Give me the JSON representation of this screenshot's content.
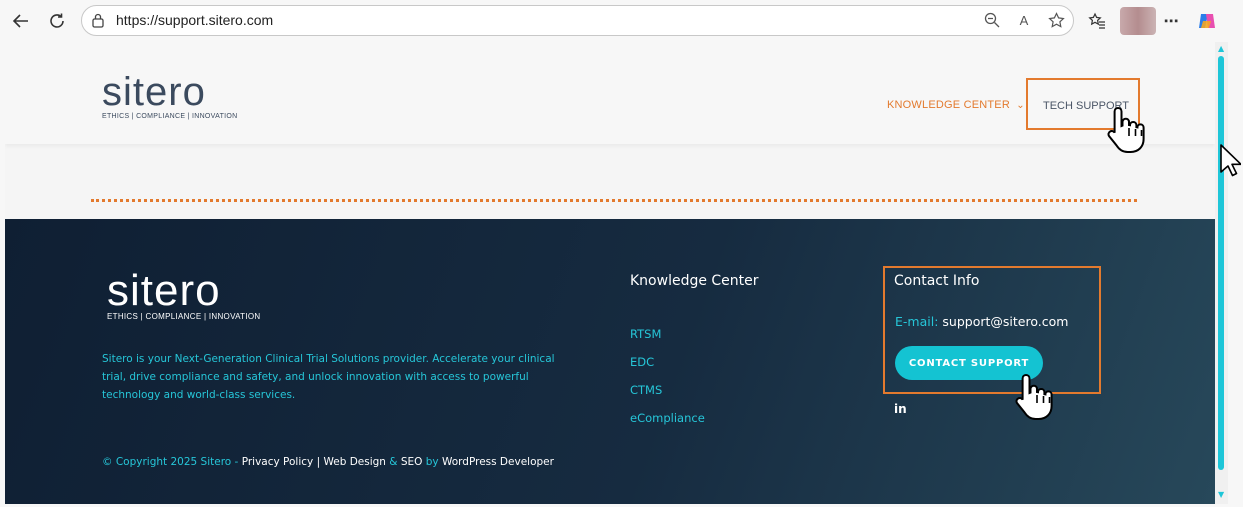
{
  "browser": {
    "url": "https://support.sitero.com"
  },
  "header": {
    "logo_word": "sitero",
    "logo_tagline": "ETHICS | COMPLIANCE | INNOVATION",
    "nav": {
      "knowledge_center": "KNOWLEDGE CENTER",
      "knowledge_center_chevron": "⌄",
      "tech_support": "TECH SUPPORT"
    }
  },
  "footer": {
    "logo_word": "sitero",
    "logo_tagline": "ETHICS | COMPLIANCE | INNOVATION",
    "description": "Sitero is your Next-Generation Clinical Trial Solutions provider. Accelerate your clinical trial, drive compliance and safety, and unlock innovation with access to powerful technology and world-class services.",
    "copyright": {
      "prefix": "© Copyright 2025 Sitero - ",
      "privacy": "Privacy Policy",
      "sep": " | ",
      "web_design": "Web Design",
      "amp": " & ",
      "seo": "SEO",
      "by": " by ",
      "developer": "WordPress Developer"
    },
    "knowledge_center": {
      "heading": "Knowledge Center",
      "links": [
        "RTSM",
        "EDC",
        "CTMS",
        "eCompliance"
      ]
    },
    "contact": {
      "heading": "Contact Info",
      "email_label": "E-mail:",
      "email_value": "support@sitero.com",
      "button": "CONTACT SUPPORT",
      "linkedin": "in"
    }
  },
  "colors": {
    "accent_orange": "#e37a2e",
    "accent_cyan": "#17c4d4",
    "footer_bg": "#0f1f33"
  }
}
